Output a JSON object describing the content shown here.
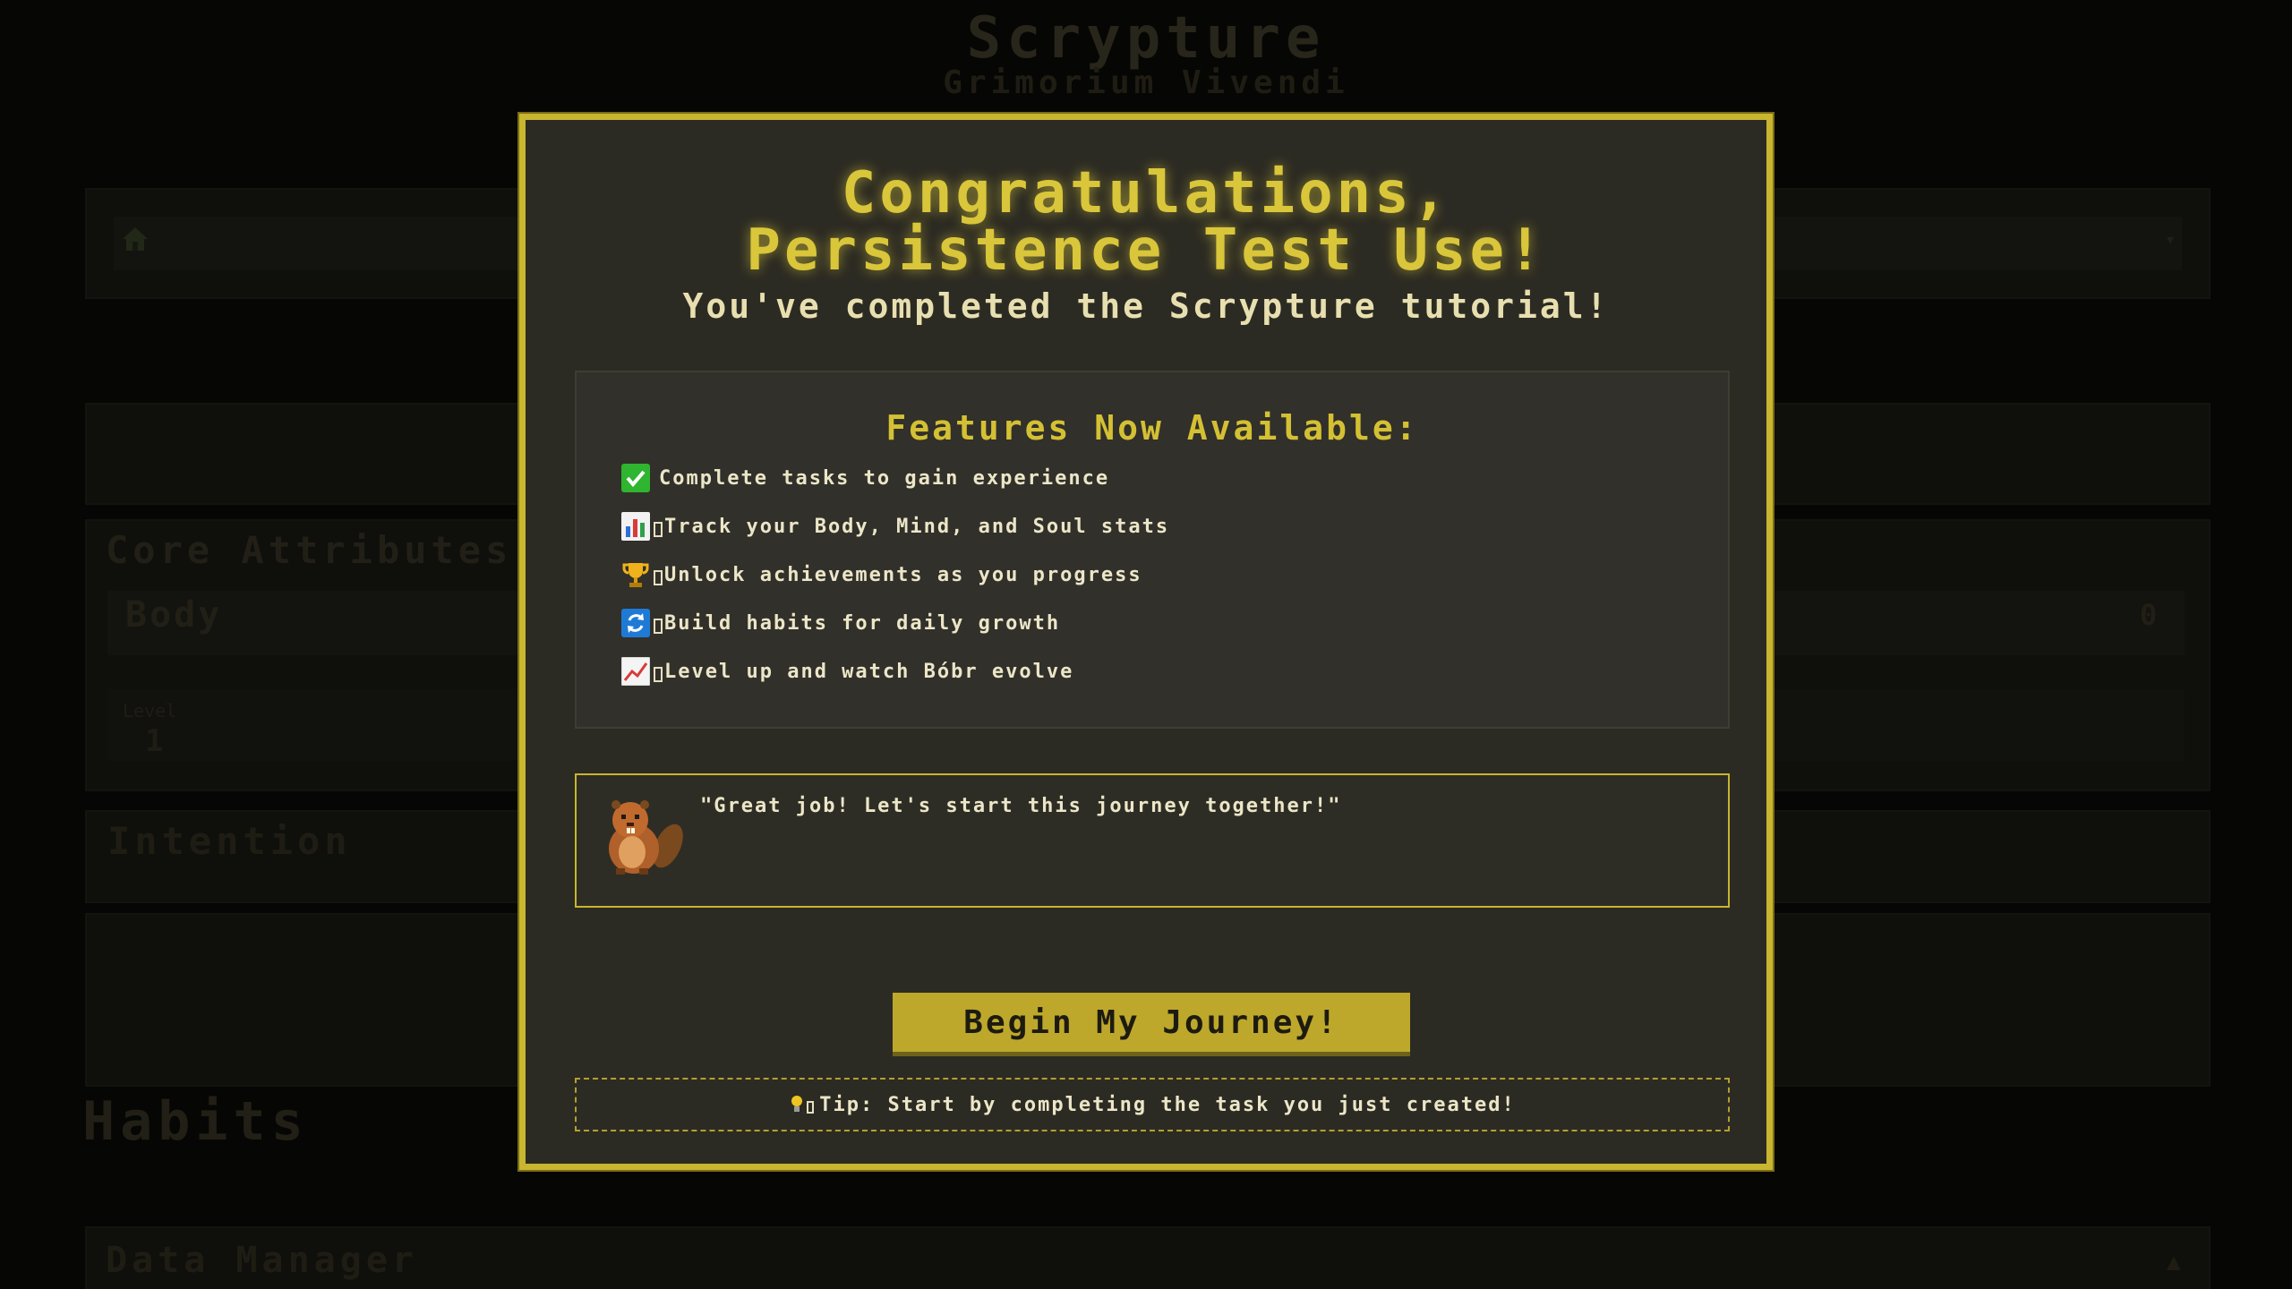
{
  "background": {
    "app_title": "Scrypture",
    "app_subtitle": "Grimorium Vivendi",
    "nav_icon": "home-icon",
    "core_attributes_title": "Core Attributes",
    "body_label": "Body",
    "body_value": "0",
    "level_label": "Level",
    "level_value": "1",
    "intention_title": "Intention",
    "habits_title": "Habits",
    "data_manager_title": "Data Manager"
  },
  "modal": {
    "title_line1": "Congratulations,",
    "title_line2": "Persistence Test Use!",
    "subtitle": "You've completed the Scrypture tutorial!",
    "features_title": "Features Now Available:",
    "features": [
      {
        "icon": "checkmark-icon",
        "text": "Complete tasks to gain experience"
      },
      {
        "icon": "bar-chart-icon",
        "text": "Track your Body, Mind, and Soul stats"
      },
      {
        "icon": "trophy-icon",
        "text": "Unlock achievements as you progress"
      },
      {
        "icon": "refresh-icon",
        "text": "Build habits for daily growth"
      },
      {
        "icon": "trending-up-icon",
        "text": "Level up and watch Bóbr evolve"
      }
    ],
    "beaver_quote": "\"Great job! Let's start this journey together!\"",
    "begin_button": "Begin My Journey!",
    "tip": "Tip: Start by completing the task you just created!"
  },
  "colors": {
    "accent_gold": "#c8b530",
    "modal_bg": "#2c2b23",
    "button_bg": "#bda82c",
    "text_light": "#ece6c8"
  }
}
